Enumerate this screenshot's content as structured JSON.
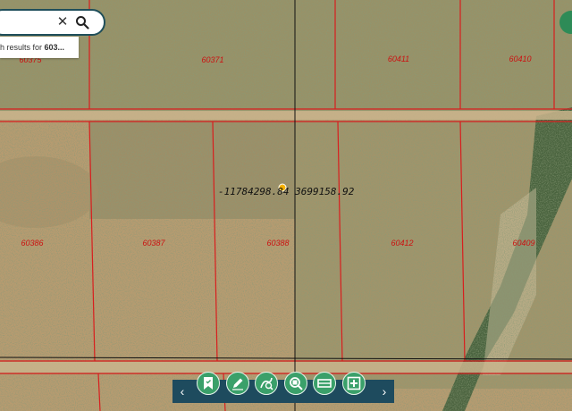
{
  "search": {
    "results_prefix": "h results for ",
    "results_query": "603..."
  },
  "map": {
    "coordinate_readout": "-11784298.84 3699158.92",
    "parcels": [
      {
        "label": "60375"
      },
      {
        "label": "60371"
      },
      {
        "label": "60411"
      },
      {
        "label": "60410"
      },
      {
        "label": "60386"
      },
      {
        "label": "60387"
      },
      {
        "label": "60388"
      },
      {
        "label": "60412"
      },
      {
        "label": "60409"
      }
    ],
    "parcel_line_color": "#d81e1e",
    "label_color": "#cc1111"
  },
  "toolbar": {
    "buttons": [
      "bookmark-icon",
      "draw-icon",
      "measure-icon",
      "zoom-search-icon",
      "layers-icon",
      "add-icon"
    ]
  }
}
